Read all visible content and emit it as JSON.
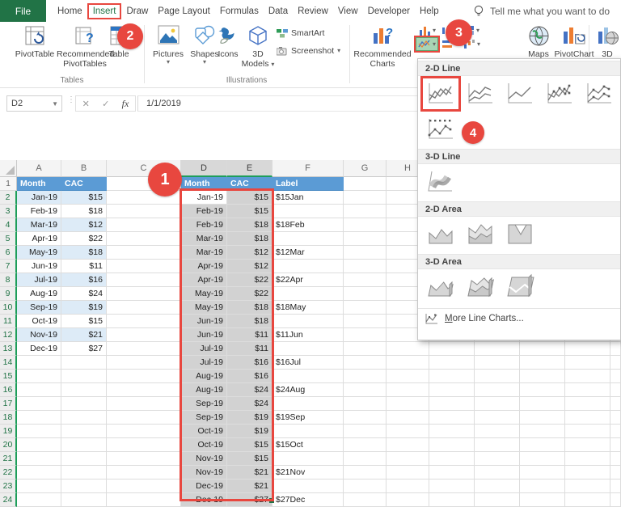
{
  "tabs": {
    "file": "File",
    "items": [
      {
        "label": "Home",
        "active": false
      },
      {
        "label": "Insert",
        "active": true
      },
      {
        "label": "Draw",
        "active": false
      },
      {
        "label": "Page Layout",
        "active": false
      },
      {
        "label": "Formulas",
        "active": false
      },
      {
        "label": "Data",
        "active": false
      },
      {
        "label": "Review",
        "active": false
      },
      {
        "label": "View",
        "active": false
      },
      {
        "label": "Developer",
        "active": false
      },
      {
        "label": "Help",
        "active": false
      }
    ],
    "tell_me": "Tell me what you want to do"
  },
  "ribbon": {
    "tables": {
      "group_label": "Tables",
      "pivottable": "PivotTable",
      "recommended_line1": "Recommended",
      "recommended_line2": "PivotTables",
      "table": "Table"
    },
    "illustrations": {
      "group_label": "Illustrations",
      "pictures": "Pictures",
      "shapes": "Shapes",
      "icons": "Icons",
      "models_line1": "3D",
      "models_line2": "Models",
      "smartart": "SmartArt",
      "screenshot": "Screenshot"
    },
    "charts": {
      "recommended_line1": "Recommended",
      "recommended_line2": "Charts",
      "maps": "Maps",
      "pivotchart": "PivotChart",
      "map3d": "3D"
    }
  },
  "formula_bar": {
    "name_box": "D2",
    "cancel": "✕",
    "enter": "✓",
    "fx": "fx",
    "value": "1/1/2019"
  },
  "chart_menu": {
    "sections": [
      {
        "title": "2-D Line"
      },
      {
        "title": "3-D Line"
      },
      {
        "title": "2-D Area"
      },
      {
        "title": "3-D Area"
      }
    ],
    "more": "More Line Charts..."
  },
  "annotations": {
    "step1": "1",
    "step2": "2",
    "step3": "3",
    "step4": "4"
  },
  "colors": {
    "accent_green": "#217346",
    "annotation_red": "#E8473F",
    "header_blue": "#5B9BD5",
    "band_blue": "#DDEBF7",
    "selection_gray": "#D2D2D2"
  },
  "sheet": {
    "col_letters": [
      "A",
      "B",
      "C",
      "D",
      "E",
      "F",
      "G",
      "H"
    ],
    "selected_cols": [
      "D",
      "E"
    ],
    "active_cell": "D2",
    "header_row": {
      "a": "Month",
      "b": "CAC",
      "d": "Month",
      "e": "CAC",
      "f": "Label"
    },
    "rows": [
      {
        "n": 2,
        "a": "Jan-19",
        "b": "$15",
        "d": "Jan-19",
        "e": "$15",
        "f": "$15Jan"
      },
      {
        "n": 3,
        "a": "Feb-19",
        "b": "$18",
        "d": "Feb-19",
        "e": "$15",
        "f": ""
      },
      {
        "n": 4,
        "a": "Mar-19",
        "b": "$12",
        "d": "Feb-19",
        "e": "$18",
        "f": "$18Feb"
      },
      {
        "n": 5,
        "a": "Apr-19",
        "b": "$22",
        "d": "Mar-19",
        "e": "$18",
        "f": ""
      },
      {
        "n": 6,
        "a": "May-19",
        "b": "$18",
        "d": "Mar-19",
        "e": "$12",
        "f": "$12Mar"
      },
      {
        "n": 7,
        "a": "Jun-19",
        "b": "$11",
        "d": "Apr-19",
        "e": "$12",
        "f": ""
      },
      {
        "n": 8,
        "a": "Jul-19",
        "b": "$16",
        "d": "Apr-19",
        "e": "$22",
        "f": "$22Apr"
      },
      {
        "n": 9,
        "a": "Aug-19",
        "b": "$24",
        "d": "May-19",
        "e": "$22",
        "f": ""
      },
      {
        "n": 10,
        "a": "Sep-19",
        "b": "$19",
        "d": "May-19",
        "e": "$18",
        "f": "$18May"
      },
      {
        "n": 11,
        "a": "Oct-19",
        "b": "$15",
        "d": "Jun-19",
        "e": "$18",
        "f": ""
      },
      {
        "n": 12,
        "a": "Nov-19",
        "b": "$21",
        "d": "Jun-19",
        "e": "$11",
        "f": "$11Jun"
      },
      {
        "n": 13,
        "a": "Dec-19",
        "b": "$27",
        "d": "Jul-19",
        "e": "$11",
        "f": ""
      },
      {
        "n": 14,
        "a": "",
        "b": "",
        "d": "Jul-19",
        "e": "$16",
        "f": "$16Jul"
      },
      {
        "n": 15,
        "a": "",
        "b": "",
        "d": "Aug-19",
        "e": "$16",
        "f": ""
      },
      {
        "n": 16,
        "a": "",
        "b": "",
        "d": "Aug-19",
        "e": "$24",
        "f": "$24Aug"
      },
      {
        "n": 17,
        "a": "",
        "b": "",
        "d": "Sep-19",
        "e": "$24",
        "f": ""
      },
      {
        "n": 18,
        "a": "",
        "b": "",
        "d": "Sep-19",
        "e": "$19",
        "f": "$19Sep"
      },
      {
        "n": 19,
        "a": "",
        "b": "",
        "d": "Oct-19",
        "e": "$19",
        "f": ""
      },
      {
        "n": 20,
        "a": "",
        "b": "",
        "d": "Oct-19",
        "e": "$15",
        "f": "$15Oct"
      },
      {
        "n": 21,
        "a": "",
        "b": "",
        "d": "Nov-19",
        "e": "$15",
        "f": ""
      },
      {
        "n": 22,
        "a": "",
        "b": "",
        "d": "Nov-19",
        "e": "$21",
        "f": "$21Nov"
      },
      {
        "n": 23,
        "a": "",
        "b": "",
        "d": "Dec-19",
        "e": "$21",
        "f": ""
      },
      {
        "n": 24,
        "a": "",
        "b": "",
        "d": "Dec-19",
        "e": "$27",
        "f": "$27Dec"
      }
    ]
  }
}
